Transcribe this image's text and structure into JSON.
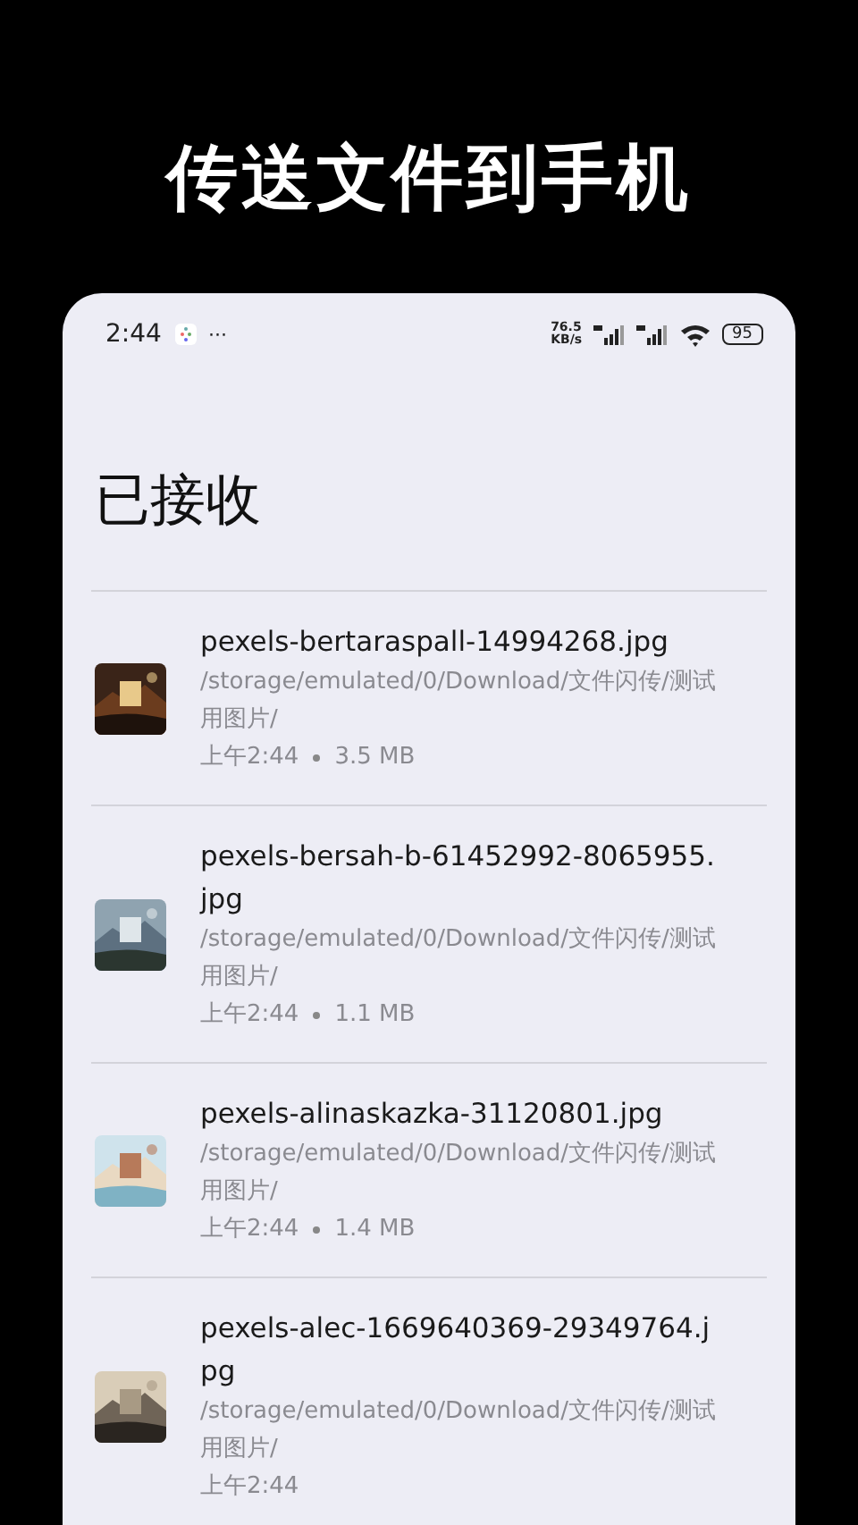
{
  "headline": "传送文件到手机",
  "status_bar": {
    "time": "2:44",
    "more": "···",
    "speed": "76.5",
    "speed_unit": "KB/s",
    "battery": "95"
  },
  "title": "已接收",
  "files": [
    {
      "name": "pexels-bertaraspall-14994268.jpg",
      "path": "/storage/emulated/0/Download/文件闪传/测试用图片/",
      "time": "上午2:44",
      "size": "3.5 MB",
      "kind": "interior"
    },
    {
      "name": "pexels-bersah-b-61452992-8065955.jpg",
      "path": "/storage/emulated/0/Download/文件闪传/测试用图片/",
      "time": "上午2:44",
      "size": "1.1 MB",
      "kind": "mountain"
    },
    {
      "name": "pexels-alinaskazka-31120801.jpg",
      "path": "/storage/emulated/0/Download/文件闪传/测试用图片/",
      "time": "上午2:44",
      "size": "1.4 MB",
      "kind": "beach"
    },
    {
      "name": "pexels-alec-1669640369-29349764.jpg",
      "path": "/storage/emulated/0/Download/文件闪传/测试用图片/",
      "time": "上午2:44",
      "kind": "street"
    }
  ]
}
